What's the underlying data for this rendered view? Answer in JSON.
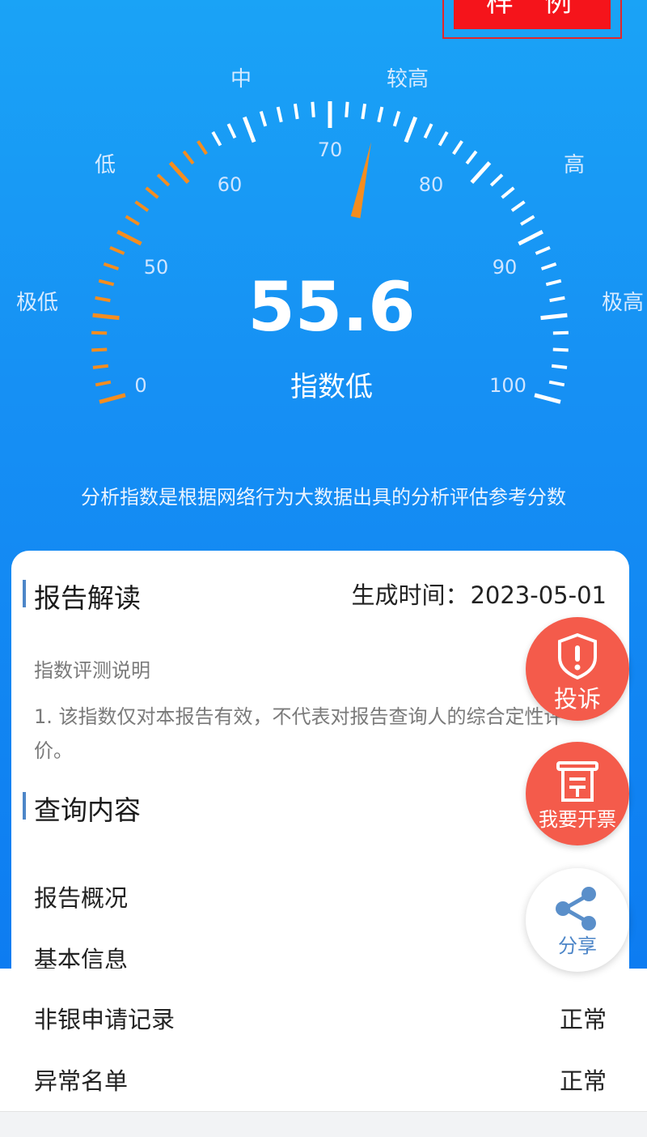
{
  "stamp": {
    "text": "样例"
  },
  "gauge": {
    "level_labels": [
      "极低",
      "低",
      "中",
      "较高",
      "高",
      "极高"
    ],
    "tick_labels": [
      "0",
      "50",
      "60",
      "70",
      "80",
      "90",
      "100"
    ],
    "min": 0,
    "max": 100,
    "value": 55.6,
    "value_text": "55.6",
    "value_desc": "指数低",
    "colors": {
      "active": "#f58d1f",
      "inactive": "#ffffff",
      "needle": "#f58d1f"
    }
  },
  "subtitle": "分析指数是根据网络行为大数据出具的分析评估参考分数",
  "report": {
    "title": "报告解读",
    "gen_time_label": "生成时间：",
    "gen_time_value": "2023-05-01",
    "desc_label": "指数评测说明",
    "desc_text": "1. 该指数仅对本报告有效，不代表对报告查询人的综合定性评价。"
  },
  "query": {
    "title": "查询内容",
    "items": [
      {
        "label": "报告概况",
        "value": ""
      },
      {
        "label": "基本信息",
        "value": ""
      },
      {
        "label": "非银申请记录",
        "value": "正常"
      },
      {
        "label": "异常名单",
        "value": "正常"
      }
    ]
  },
  "floating": {
    "complaint_label": "投诉",
    "invoice_label": "我要开票",
    "share_label": "分享",
    "icons": [
      "shield-alert-icon",
      "receipt-icon",
      "share-icon"
    ],
    "colors": {
      "primary": "#f45b4b",
      "share": "#4d86c8"
    }
  }
}
